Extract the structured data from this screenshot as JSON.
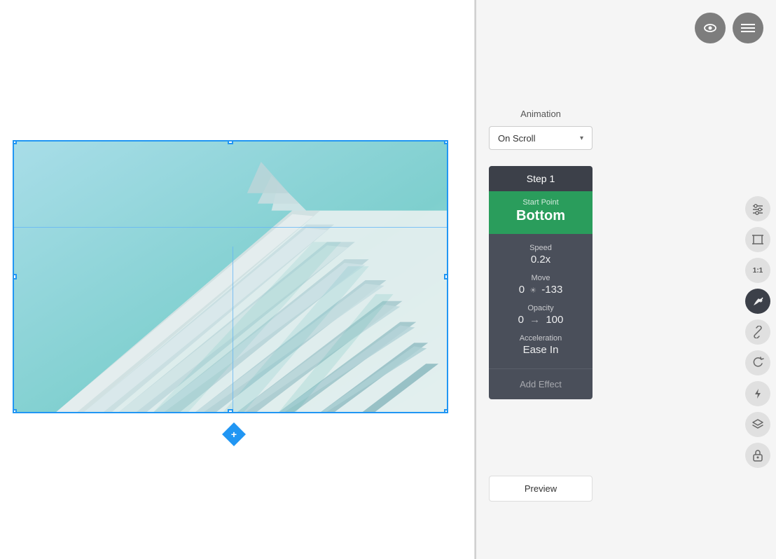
{
  "header": {
    "eye_icon": "👁",
    "menu_icon": "☰"
  },
  "animation": {
    "section_title": "Animation",
    "dropdown_label": "On Scroll",
    "dropdown_arrow": "▾"
  },
  "step": {
    "header_label": "Step 1",
    "start_point_label": "Start Point",
    "start_point_value": "Bottom",
    "speed_label": "Speed",
    "speed_value": "0.2x",
    "move_label": "Move",
    "move_value": "0 ☀ -133",
    "opacity_label": "Opacity",
    "opacity_value": "0 → 100",
    "acceleration_label": "Acceleration",
    "acceleration_value": "Ease In",
    "add_effect_label": "Add Effect"
  },
  "preview": {
    "label": "Preview"
  },
  "side_icons": [
    {
      "name": "settings-icon",
      "symbol": "⚙",
      "dark": false
    },
    {
      "name": "crop-icon",
      "symbol": "⬜",
      "dark": false
    },
    {
      "name": "ratio-icon",
      "symbol": "1:1",
      "dark": false,
      "text": true
    },
    {
      "name": "paint-icon",
      "symbol": "🎨",
      "dark": true
    },
    {
      "name": "link-icon",
      "symbol": "🔗",
      "dark": false
    },
    {
      "name": "rotate-icon",
      "symbol": "↻",
      "dark": false
    },
    {
      "name": "move-icon",
      "symbol": "✈",
      "dark": false
    },
    {
      "name": "layers-icon",
      "symbol": "⬟",
      "dark": false
    },
    {
      "name": "lock-icon",
      "symbol": "🔒",
      "dark": false
    }
  ],
  "canvas": {
    "add_button": "+"
  }
}
